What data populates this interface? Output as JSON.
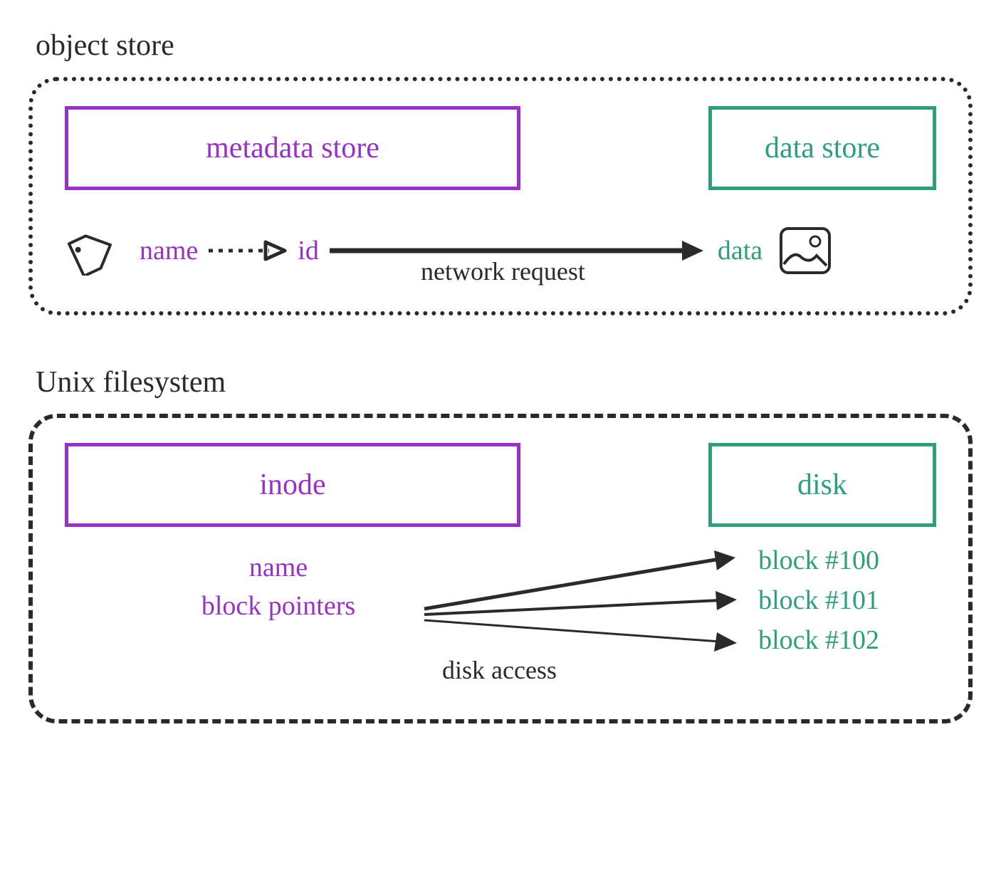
{
  "object_store": {
    "title": "object store",
    "metadata_box": "metadata store",
    "data_box": "data store",
    "name_label": "name",
    "id_label": "id",
    "data_label": "data",
    "request_label": "network request"
  },
  "unix_filesystem": {
    "title": "Unix filesystem",
    "inode_box": "inode",
    "disk_box": "disk",
    "name_field": "name",
    "block_pointers_field": "block pointers",
    "access_label": "disk access",
    "blocks": [
      "block #100",
      "block #101",
      "block #102"
    ]
  },
  "colors": {
    "purple": "#9832c7",
    "green": "#2f9e7a",
    "black": "#2a2a2a"
  }
}
